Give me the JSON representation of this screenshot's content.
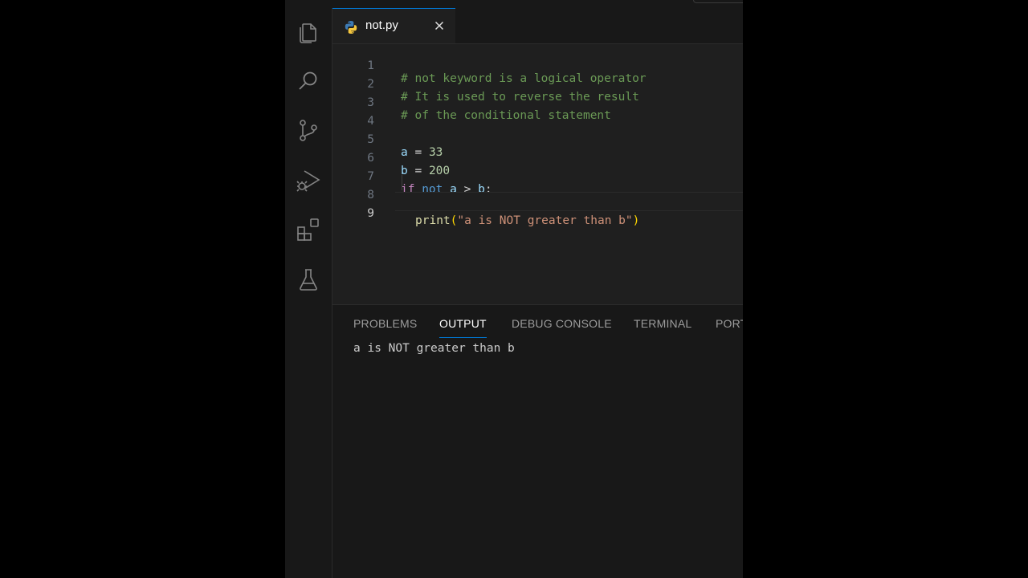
{
  "activity_bar": {
    "icons": [
      "explorer-icon",
      "search-icon",
      "source-control-icon",
      "run-debug-icon",
      "extensions-icon",
      "testing-icon"
    ]
  },
  "tab": {
    "filename": "not.py",
    "file_icon": "python-icon"
  },
  "code": {
    "line_numbers": [
      "1",
      "2",
      "3",
      "4",
      "5",
      "6",
      "7",
      "8",
      "9"
    ],
    "line1": "# not keyword is a logical operator",
    "line2": "# It is used to reverse the result",
    "line3": "# of the conditional statement",
    "line5": {
      "var": "a",
      "op": " = ",
      "num": "33"
    },
    "line6": {
      "var": "b",
      "op": " = ",
      "num": "200"
    },
    "line7": {
      "kw_if": "if",
      "kw_not": "not",
      "var_a": "a",
      "op": " > ",
      "var_b": "b",
      "colon": ":"
    },
    "line8": {
      "fn": "print",
      "open": "(",
      "str": "\"a is NOT greater than b\"",
      "close": ")"
    }
  },
  "panel": {
    "tabs": [
      "PROBLEMS",
      "OUTPUT",
      "DEBUG CONSOLE",
      "TERMINAL",
      "PORTS"
    ],
    "active_tab": "OUTPUT",
    "output": "a is NOT greater than b"
  },
  "colors": {
    "accent": "#0078d4",
    "background": "#1f1f1f",
    "comment": "#6a9955"
  }
}
